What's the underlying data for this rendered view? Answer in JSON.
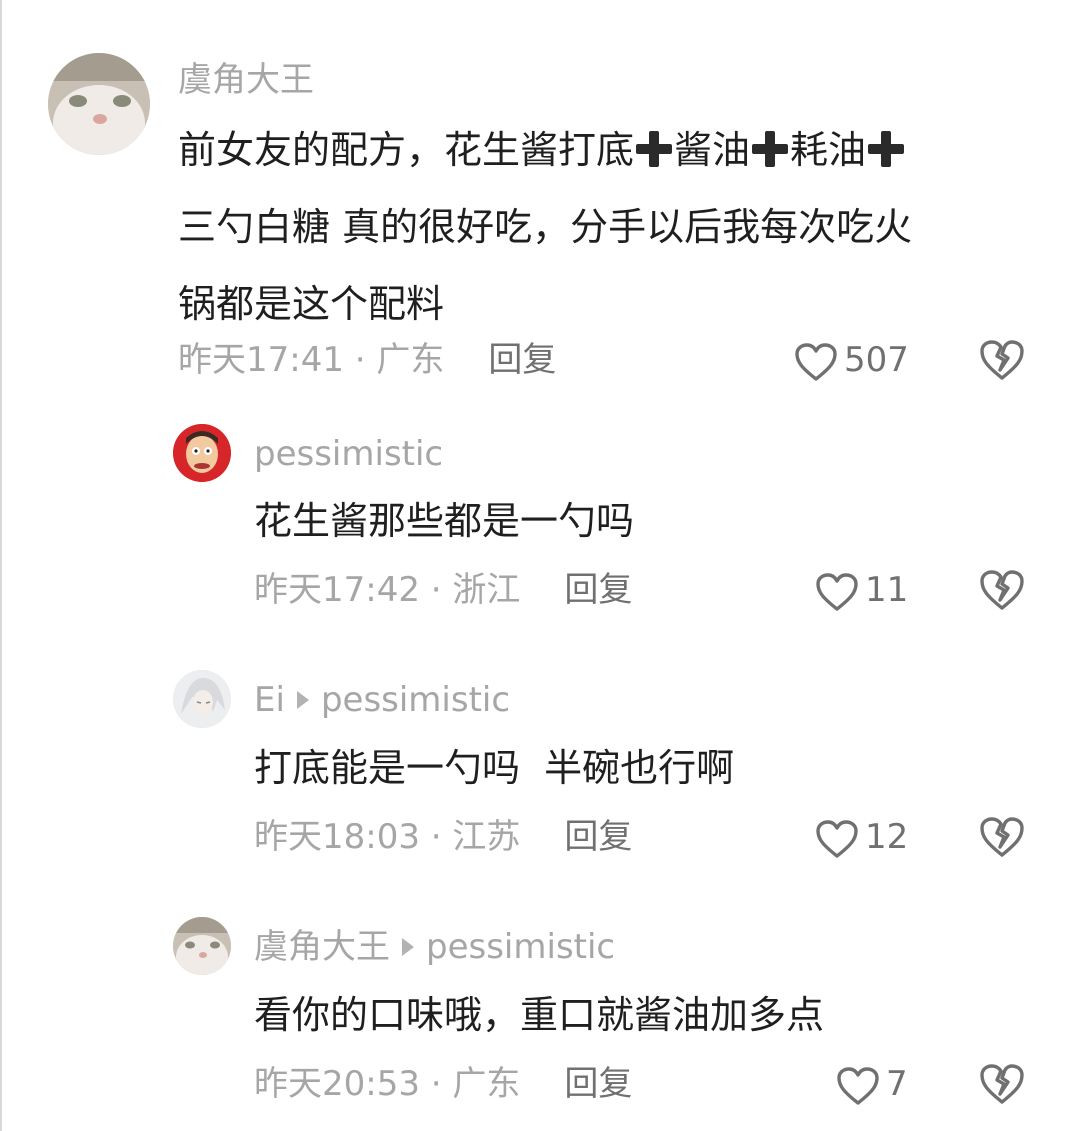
{
  "comments": [
    {
      "name": "虞角大王",
      "text_line1": "前女友的配方，花生酱打底",
      "text_seg2": "酱油",
      "text_seg3": "耗油",
      "text_line2": "三勺白糖 真的很好吃，分手以后我每次吃火",
      "text_line3": "锅都是这个配料",
      "time": "昨天17:41 · 广东",
      "reply": "回复",
      "likes": "507"
    },
    {
      "name": "pessimistic",
      "text": "花生酱那些都是一勺吗",
      "time": "昨天17:42 · 浙江",
      "reply": "回复",
      "likes": "11"
    },
    {
      "name": "Ei",
      "reply_to": "pessimistic",
      "text": "打底能是一勺吗  半碗也行啊",
      "time": "昨天18:03 · 江苏",
      "reply": "回复",
      "likes": "12"
    },
    {
      "name": "虞角大王",
      "reply_to": "pessimistic",
      "text": "看你的口味哦，重口就酱油加多点",
      "time": "昨天20:53 · 广东",
      "reply": "回复",
      "likes": "7"
    }
  ],
  "icons": {
    "like": "heart-outline-icon",
    "dislike": "broken-heart-icon",
    "reply_arrow": "triangle-right-icon"
  },
  "colors": {
    "text": "#1f1f1f",
    "secondary": "#a6a6a6",
    "reply": "#707070"
  }
}
